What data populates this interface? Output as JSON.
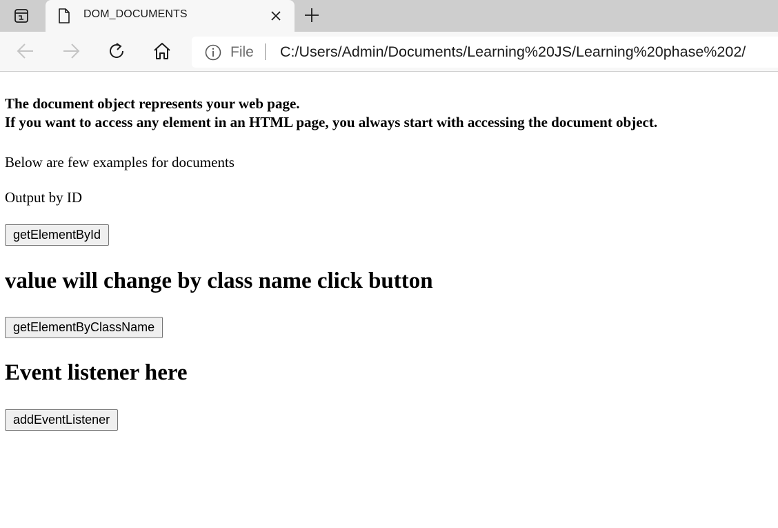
{
  "browser": {
    "tab_title": "DOM_DOCUMENTS",
    "address_scheme": "File",
    "address_url": "C:/Users/Admin/Documents/Learning%20JS/Learning%20phase%202/"
  },
  "page": {
    "intro_line1": "The document object represents your web page.",
    "intro_line2": "If you want to access any element in an HTML page, you always start with accessing the document object.",
    "examples_text": "Below are few examples for documents",
    "output_by_id": "Output by ID",
    "btn_get_by_id": "getElementById",
    "heading_class": "value will change by class name click button",
    "btn_get_by_class": "getElementByClassName",
    "heading_event": "Event listener here",
    "btn_add_listener": "addEventListener"
  }
}
